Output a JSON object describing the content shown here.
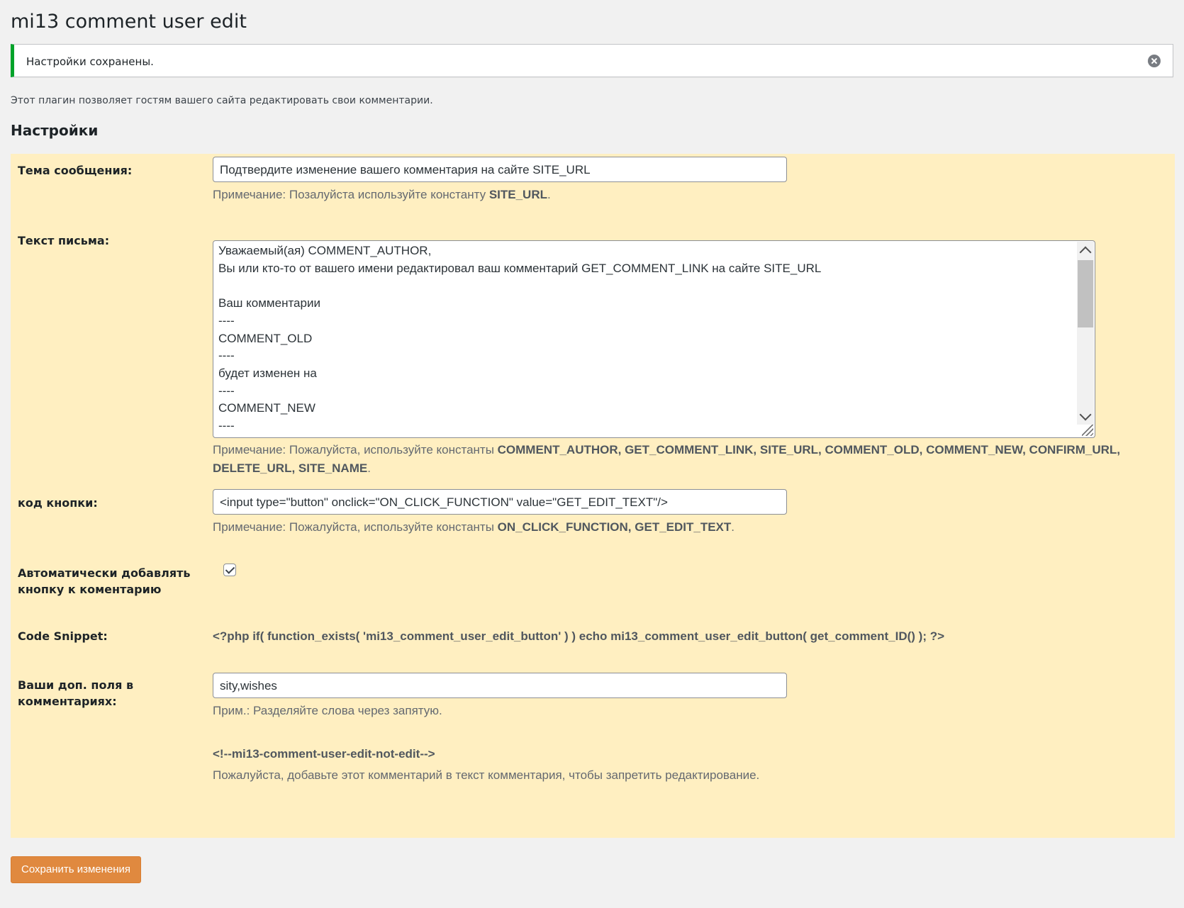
{
  "page": {
    "title": "mi13 comment user edit",
    "notice": "Настройки сохранены.",
    "intro": "Этот плагин позволяет гостям вашего сайта редактировать свои комментарии.",
    "section_title": "Настройки"
  },
  "fields": {
    "subject": {
      "label": "Тема сообщения:",
      "value": "Подтвердите изменение вашего комментария на сайте SITE_URL",
      "note_prefix": "Примечание: Позалуйста используйте константу ",
      "note_const": "SITE_URL",
      "note_suffix": "."
    },
    "body": {
      "label": "Текст письма:",
      "lines": [
        "Уважаемый(ая) COMMENT_AUTHOR,",
        "Вы или кто-то от вашего имени редактировал ваш комментарий GET_COMMENT_LINK на сайте SITE_URL",
        "",
        "Ваш комментарии",
        "----",
        "COMMENT_OLD",
        "----",
        "будет изменен на",
        "----",
        "COMMENT_NEW",
        "----"
      ],
      "note_prefix": "Примечание: Пожалуйста, используйте константы ",
      "note_consts_line1": "COMMENT_AUTHOR, GET_COMMENT_LINK, SITE_URL, COMMENT_OLD, COMMENT_NEW, CONFIRM_URL,",
      "note_consts_line2": "DELETE_URL, SITE_NAME",
      "note_suffix": "."
    },
    "button_code": {
      "label": "код кнопки:",
      "value": "<input type=\"button\" onclick=\"ON_CLICK_FUNCTION\" value=\"GET_EDIT_TEXT\"/>",
      "note_prefix": "Примечание: Пожалуйста, используйте константы ",
      "note_const": "ON_CLICK_FUNCTION, GET_EDIT_TEXT",
      "note_suffix": "."
    },
    "auto_add": {
      "label_line1": "Автоматически добавлять",
      "label_line2": "кнопку к коментарию",
      "checked": true
    },
    "code_snippet": {
      "label": "Code Snippet:",
      "value": "<?php if( function_exists( 'mi13_comment_user_edit_button' ) ) echo mi13_comment_user_edit_button( get_comment_ID() ); ?>"
    },
    "extra_fields": {
      "label_line1": "Ваши доп. поля в",
      "label_line2": "комментариях:",
      "value": "sity,wishes",
      "note": "Прим.: Разделяйте слова через запятую."
    },
    "not_edit": {
      "code": "<!--mi13-comment-user-edit-not-edit-->",
      "note": "Пожалуйста, добавьте этот комментарий в текст комментария, чтобы запретить редактирование."
    }
  },
  "submit_label": "Сохранить изменения",
  "colors": {
    "background": "#f1f1f1",
    "panel": "#ffefc1",
    "notice_accent": "#00a32a",
    "submit": "#e0893f"
  }
}
